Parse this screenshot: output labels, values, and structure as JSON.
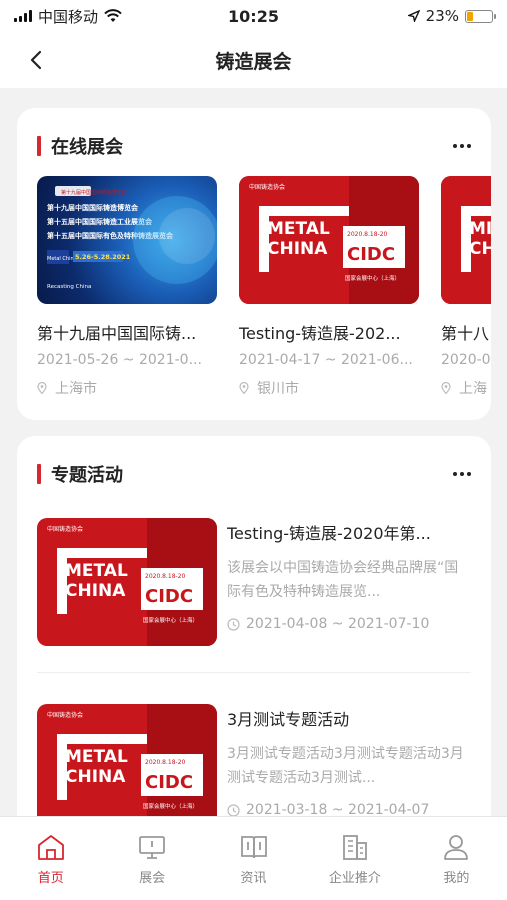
{
  "status_bar": {
    "carrier": "中国移动",
    "time": "10:25",
    "battery": "23%",
    "battery_level": 0.23
  },
  "header": {
    "title": "铸造展会"
  },
  "online_section": {
    "title": "在线展会",
    "expos": [
      {
        "name": "第十九届中国国际铸...",
        "dates": "2021-05-26 ~ 2021-0...",
        "city": "上海市",
        "thumb_text": [
          "第十九届中国国际铸造博览会",
          "第十五届中国国际铸造工业展览会",
          "第十五届中国国际有色及特种铸造展览会",
          "5.26-5.28.2021",
          "Metal China",
          "Recasting China"
        ]
      },
      {
        "name": "Testing-铸造展-202...",
        "dates": "2021-04-17 ~ 2021-06...",
        "city": "银川市",
        "thumb_text": [
          "中国铸造协会",
          "METAL",
          "CHINA",
          "2020.8.18-20",
          "CIDC",
          "国家会展中心（上海）"
        ]
      },
      {
        "name": "第十八",
        "dates": "2020-0",
        "city": "上海",
        "thumb_text": [
          "MI",
          "CH"
        ]
      }
    ]
  },
  "topics_section": {
    "title": "专题活动",
    "items": [
      {
        "title": "Testing-铸造展-2020年第...",
        "desc": "该展会以中国铸造协会经典品牌展“国际有色及特种铸造展览...",
        "dates": "2021-04-08 ~ 2021-07-10",
        "thumb_text": [
          "中国铸造协会",
          "METAL",
          "CHINA",
          "2020.8.18-20",
          "CIDC",
          "国家会展中心（上海）"
        ]
      },
      {
        "title": "3月测试专题活动",
        "desc": "3月测试专题活动3月测试专题活动3月测试专题活动3月测试...",
        "dates": "2021-03-18 ~ 2021-04-07",
        "thumb_text": [
          "中国铸造协会",
          "METAL",
          "CHINA",
          "2020.8.18-20",
          "CIDC",
          "国家会展中心（上海）"
        ]
      }
    ]
  },
  "tabbar": {
    "tabs": [
      {
        "label": "首页",
        "icon": "home-icon",
        "active": true
      },
      {
        "label": "展会",
        "icon": "monitor-icon",
        "active": false
      },
      {
        "label": "资讯",
        "icon": "book-icon",
        "active": false
      },
      {
        "label": "企业推介",
        "icon": "building-icon",
        "active": false
      },
      {
        "label": "我的",
        "icon": "user-icon",
        "active": false
      }
    ]
  },
  "colors": {
    "accent": "#d8262f",
    "thumb_red": "#c8161d",
    "muted": "#aaaaaa"
  }
}
